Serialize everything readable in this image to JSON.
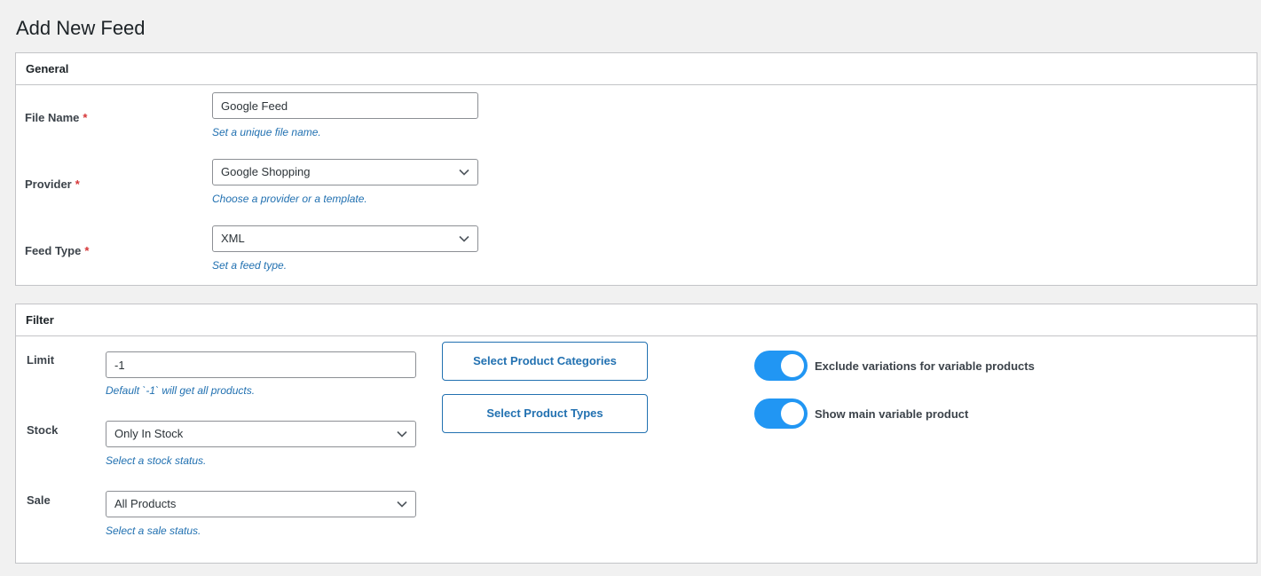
{
  "page": {
    "title": "Add New Feed"
  },
  "general": {
    "header": "General",
    "file_name": {
      "label": "File Name",
      "required_mark": "*",
      "value": "Google Feed",
      "hint": "Set a unique file name."
    },
    "provider": {
      "label": "Provider",
      "required_mark": "*",
      "selected": "Google Shopping",
      "hint": "Choose a provider or a template."
    },
    "feed_type": {
      "label": "Feed Type",
      "required_mark": "*",
      "selected": "XML",
      "hint": "Set a feed type."
    }
  },
  "filter": {
    "header": "Filter",
    "limit": {
      "label": "Limit",
      "value": "-1",
      "hint": "Default `-1` will get all products."
    },
    "stock": {
      "label": "Stock",
      "selected": "Only In Stock",
      "hint": "Select a stock status."
    },
    "sale": {
      "label": "Sale",
      "selected": "All Products",
      "hint": "Select a sale status."
    },
    "buttons": {
      "categories": "Select Product Categories",
      "types": "Select Product Types"
    },
    "toggles": {
      "exclude_variations": {
        "label": "Exclude variations for variable products",
        "on": true
      },
      "show_main_variable": {
        "label": "Show main variable product",
        "on": true
      }
    }
  },
  "colors": {
    "accent": "#2271b1",
    "toggle_on": "#2196f3",
    "required": "#d63638",
    "background": "#f1f1f1",
    "border": "#c3c4c7"
  },
  "icons": {
    "select_arrow": "chevron-down-icon"
  }
}
